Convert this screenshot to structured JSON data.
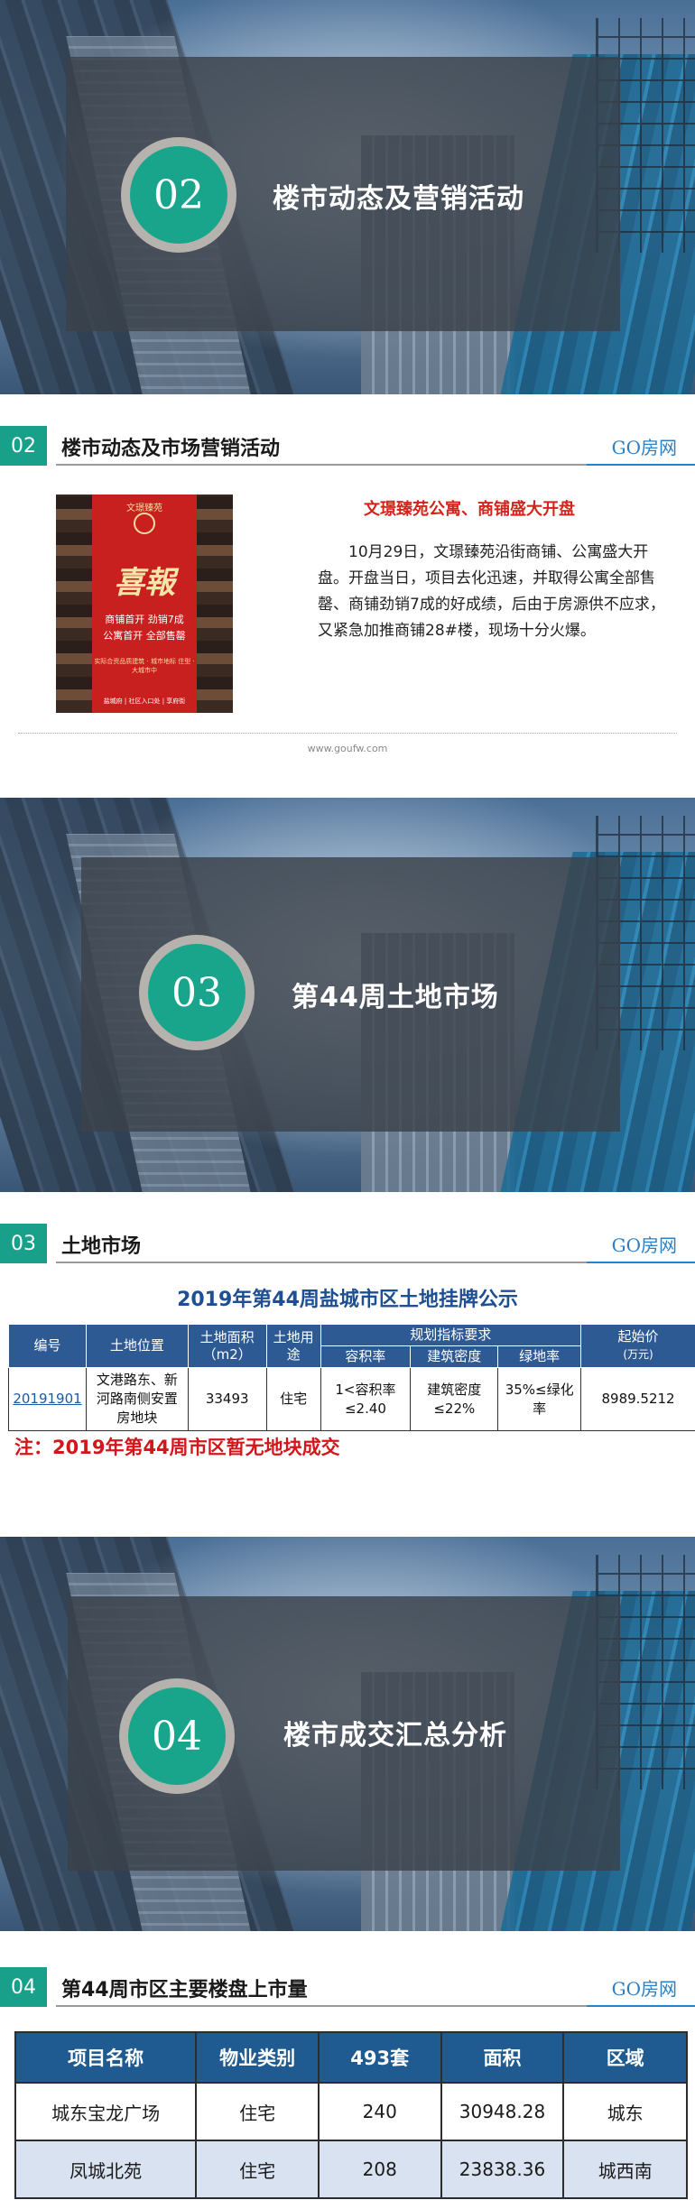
{
  "banners": [
    {
      "num": "02",
      "title": "楼市动态及营销活动"
    },
    {
      "num": "03",
      "title": "第44周土地市场"
    },
    {
      "num": "04",
      "title": "楼市成交汇总分析"
    }
  ],
  "logo": "GO房网",
  "section02": {
    "num": "02",
    "title": "楼市动态及市场营销活动",
    "poster": {
      "brand": "文璟臻苑",
      "headline": "喜報",
      "line1": "商铺首开 劲销7成",
      "line2": "公寓首开 全部售罄",
      "line3": "实际合资品质建筑 · 城市地标 住型 · 大城市中",
      "footer": "盐城府 | 社区入口处 | 享府街"
    },
    "news_title": "文璟臻苑公寓、商铺盛大开盘",
    "news_body": "10月29日，文璟臻苑沿街商铺、公寓盛大开盘。开盘当日，项目去化迅速，并取得公寓全部售罄、商铺劲销7成的好成绩，后由于房源供不应求，又紧急加推商铺28#楼，现场十分火爆。",
    "site_url": "www.goufw.com"
  },
  "section03": {
    "num": "03",
    "title": "土地市场",
    "table_title": "2019年第44周盐城市区土地挂牌公示",
    "headers": {
      "id": "编号",
      "location": "土地位置",
      "area": "土地面积（m2）",
      "use": "土地用途",
      "plan": "规划指标要求",
      "far": "容积率",
      "density": "建筑密度",
      "green": "绿地率",
      "price": "起始价",
      "price_unit": "(万元)"
    },
    "rows": [
      {
        "id": "20191901",
        "location": "文港路东、新河路南侧安置房地块",
        "area": "33493",
        "use": "住宅",
        "far": "1<容积率≤2.40",
        "density": "建筑密度≤22%",
        "green": "35%≤绿化率",
        "price": "8989.5212"
      }
    ],
    "note": "注：2019年第44周市区暂无地块成交"
  },
  "section04": {
    "num": "04",
    "title": "第44周市区主要楼盘上市量",
    "headers": [
      "项目名称",
      "物业类别",
      "493套",
      "面积",
      "区域"
    ],
    "rows": [
      [
        "城东宝龙广场",
        "住宅",
        "240",
        "30948.28",
        "城东"
      ],
      [
        "凤城北苑",
        "住宅",
        "208",
        "23838.36",
        "城西南"
      ]
    ]
  }
}
